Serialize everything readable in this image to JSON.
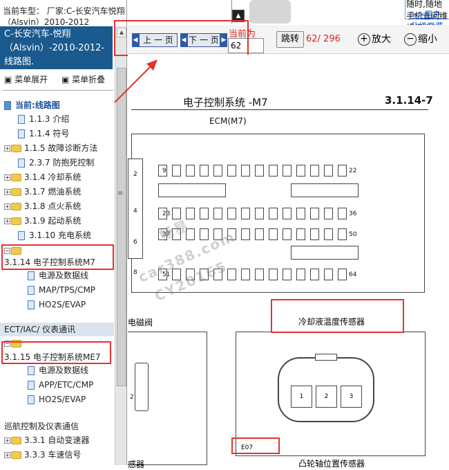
{
  "left": {
    "topline": "当前车型： 厂家:C-长安汽车悦翔（Alsvin）2010-2012",
    "model_title": "C-长安汽车-悦翔（Alsvin）-2010-2012- 线路图.",
    "expand_label": "菜单展开",
    "collapse_label": "菜单折叠",
    "current_label": "当前:线路图",
    "items": [
      {
        "label": "1.1.3 介绍"
      },
      {
        "label": "1.1.4 符号"
      },
      {
        "label": "1.1.5 故障诊断方法"
      },
      {
        "label": "2.3.7 防抱死控制"
      },
      {
        "label": "3.1.4 冷却系统"
      },
      {
        "label": "3.1.7 燃油系统"
      },
      {
        "label": "3.1.8 点火系统"
      },
      {
        "label": "3.1.9 起动系统"
      },
      {
        "label": "3.1.10 充电系统"
      }
    ],
    "m7_label": "3.1.14 电子控制系统M7",
    "m7_children": [
      {
        "label": "电源及数据线"
      },
      {
        "label": "MAP/TPS/CMP"
      },
      {
        "label": "HO2S/EVAP"
      }
    ],
    "gray_row": "ECT/IAC/ 仪表通讯",
    "me7_label": "3.1.15 电子控制系统ME7",
    "me7_children": [
      {
        "label": "电源及数据线"
      },
      {
        "label": "APP/ETC/CMP"
      },
      {
        "label": "HO2S/EVAP"
      }
    ],
    "cruise_label": "巡航控制及仪表通信",
    "items_bottom": [
      {
        "label": "3.3.1 自动变速器"
      },
      {
        "label": "3.3.3 车速信号"
      }
    ]
  },
  "ad": {
    "line1": "随时,随地手机查阅维修资料",
    "line2": ">>用户升级缴费"
  },
  "toolbar": {
    "prev_label": "上 一 页",
    "next_label": "下 一 页",
    "current_label": "当前为",
    "current_value": "62",
    "jump_label": "跳转",
    "page_count": "62/ 296",
    "zoom_in_label": "放大",
    "zoom_out_label": "缩小"
  },
  "diagram": {
    "title": "电子控制系统 -M7",
    "code": "3.1.14-7",
    "ecm_label": "ECM(M7)",
    "pins_left": [
      "2",
      "4",
      "6",
      "8"
    ],
    "pin_labels": [
      "9",
      "22",
      "23",
      "36",
      "37",
      "50",
      "51",
      "64"
    ],
    "solenoid_label": "电磁阀",
    "coolant_label": "冷却液温度传感器",
    "connector_pins": [
      "1",
      "2",
      "3"
    ],
    "left_box_pin": "2",
    "connector_code": "E07",
    "bottom_right_label": "凸轮轴位置传感器",
    "bottom_left_label": "感器"
  },
  "watermark": [
    "畅易",
    "car388.com",
    "CY20165"
  ],
  "colors": {
    "panel_blue": "#1a5a8e",
    "highlight_red": "#e53030",
    "page_count_red": "#dd2222"
  }
}
